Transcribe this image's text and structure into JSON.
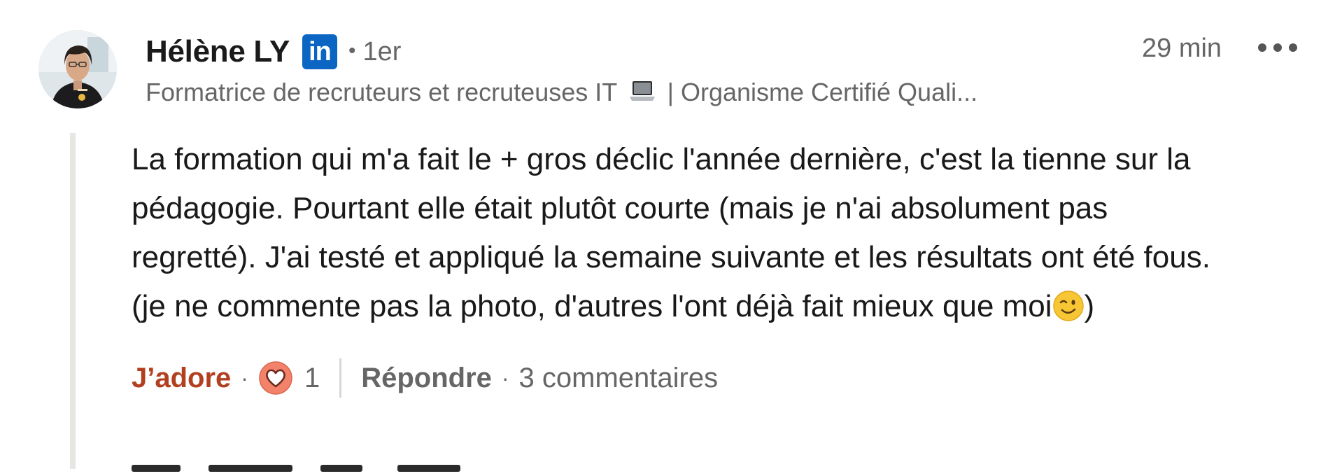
{
  "comment": {
    "author": {
      "name": "Hélène LY",
      "badge_text": "in",
      "badge_color": "#0a66c2",
      "connection_degree": "1er",
      "degree_separator": "•",
      "headline_part1": "Formatrice de recruteurs et recruteuses IT",
      "headline_emoji_icon": "laptop-icon",
      "headline_part2": "| Organisme Certifié Quali..."
    },
    "timestamp": "29 min",
    "more_icon": "more-horizontal-icon",
    "body_lines": [
      "La formation qui m'a fait le + gros déclic l'année dernière, c'est la tienne sur la",
      "pédagogie. Pourtant elle était plutôt courte (mais je n'ai absolument pas",
      "regretté). J'ai testé et appliqué la semaine suivante et les résultats ont été fous.",
      "(je ne commente pas la photo, d'autres l'ont déjà fait mieux que moi",
      ")"
    ],
    "body_emoji_icon": "winking-face-icon",
    "actions": {
      "reaction_label": "J’adore",
      "reaction_color": "#b24020",
      "separator": "·",
      "reaction_icon": "heart-reaction-icon",
      "reaction_count": "1",
      "reply_label": "Répondre",
      "replies_count": "3 commentaires"
    }
  }
}
